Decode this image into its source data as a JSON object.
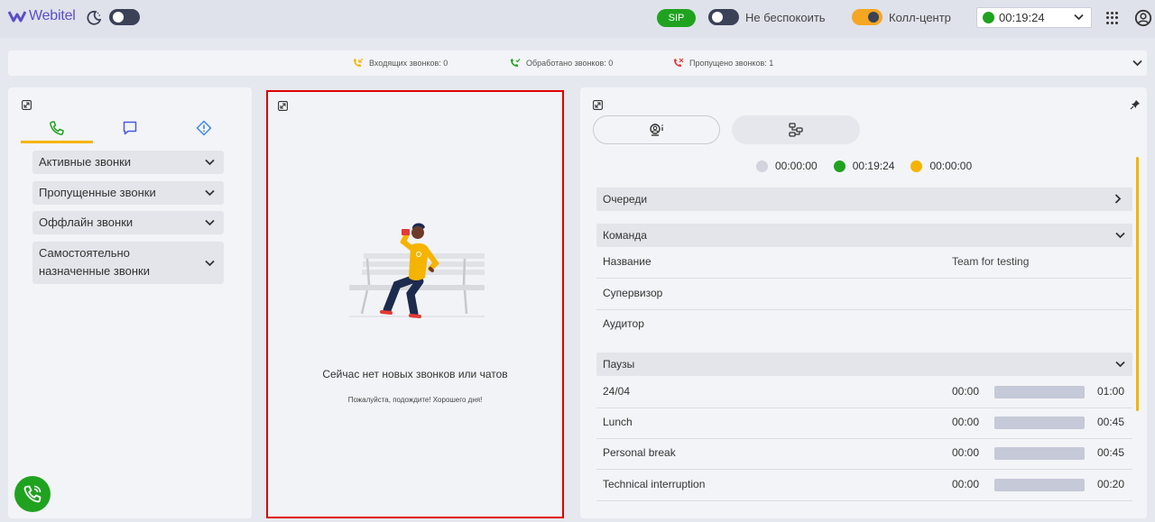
{
  "header": {
    "logo_text": "Webitel",
    "sip_label": "SIP",
    "dnd_label": "Не беспокоить",
    "callcenter_label": "Колл-центр",
    "status_time": "00:19:24",
    "colors": {
      "accent": "#f5b400",
      "online": "#1fa31f",
      "logo": "#5a4fc8"
    }
  },
  "stats": {
    "incoming_label": "Входящих звонков: 0",
    "handled_label": "Обработано звонков: 0",
    "missed_label": "Пропущено звонков: 1"
  },
  "left": {
    "tabs": [
      {
        "icon": "phone-icon",
        "active": true
      },
      {
        "icon": "chat-icon",
        "active": false
      },
      {
        "icon": "alert-icon",
        "active": false
      }
    ],
    "sections": [
      {
        "label": "Активные звонки"
      },
      {
        "label": "Пропущенные звонки"
      },
      {
        "label": "Оффлайн звонки"
      },
      {
        "label_line1": "Самостоятельно",
        "label_line2": "назначенные звонки"
      }
    ]
  },
  "center": {
    "empty_title": "Сейчас нет новых звонков или чатов",
    "empty_subtitle": "Пожалуйста, подождите! Хорошего дня!"
  },
  "right": {
    "timers": [
      {
        "value": "00:00:00",
        "color": "#d1d4dc"
      },
      {
        "value": "00:19:24",
        "color": "#1fa31f"
      },
      {
        "value": "00:00:00",
        "color": "#f5b400"
      }
    ],
    "queues_label": "Очереди",
    "team_label": "Команда",
    "team_rows": [
      {
        "key": "Название",
        "value": "Team for testing"
      },
      {
        "key": "Супервизор",
        "value": ""
      },
      {
        "key": "Аудитор",
        "value": ""
      }
    ],
    "pauses_label": "Паузы",
    "pauses": [
      {
        "name": "24/04",
        "start": "00:00",
        "end": "01:00",
        "progress": 0
      },
      {
        "name": "Lunch",
        "start": "00:00",
        "end": "00:45",
        "progress": 0
      },
      {
        "name": "Personal break",
        "start": "00:00",
        "end": "00:45",
        "progress": 0
      },
      {
        "name": "Technical interruption",
        "start": "00:00",
        "end": "00:20",
        "progress": 0
      }
    ]
  }
}
